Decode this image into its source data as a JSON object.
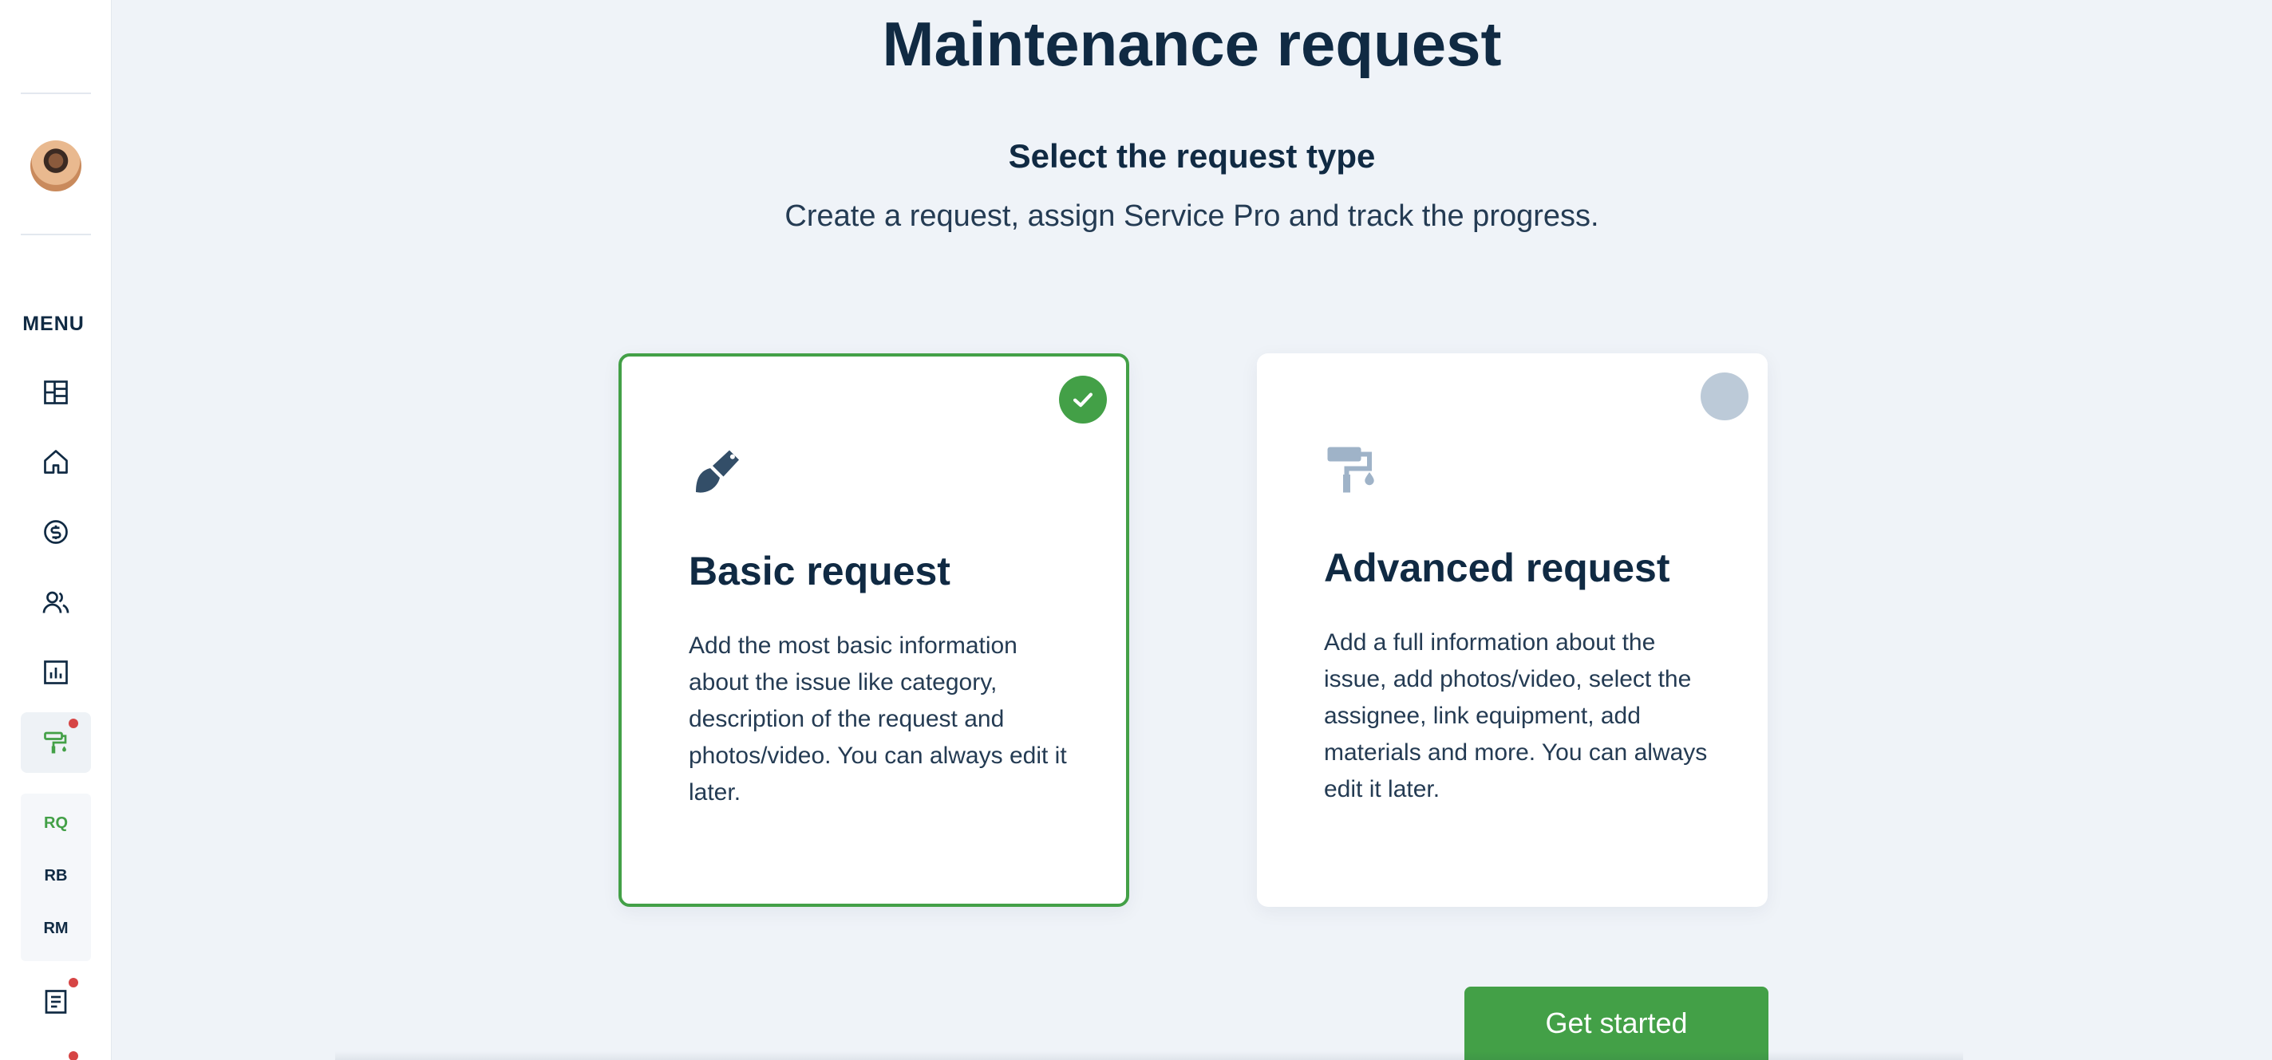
{
  "sidebar": {
    "menu_label": "MENU",
    "icons": [
      "dashboard-icon",
      "home-icon",
      "dollar-icon",
      "users-icon",
      "chart-icon",
      "paint-roller-icon",
      "document-icon"
    ],
    "submenu": [
      {
        "label": "RQ",
        "active": true
      },
      {
        "label": "RB",
        "active": false
      },
      {
        "label": "RM",
        "active": false
      }
    ],
    "notification_color": "#d64545"
  },
  "main": {
    "title": "Maintenance request",
    "subtitle": "Select the request type",
    "description": "Create a request, assign Service Pro and track the progress.",
    "cards": [
      {
        "title": "Basic request",
        "text": "Add the most basic information about the issue like category, description of the request and photos/video. You can always edit it later.",
        "icon": "paint-brush-icon",
        "selected": true
      },
      {
        "title": "Advanced request",
        "text": "Add a full information about the issue, add photos/video, select the assignee, link equipment, add materials and more. You can always edit it later.",
        "icon": "paint-roller-icon",
        "selected": false
      }
    ],
    "cta_label": "Get started"
  },
  "colors": {
    "accent": "#43a047",
    "text_primary": "#102a43",
    "background": "#eff3f8",
    "unselected_radio": "#bccad8"
  }
}
